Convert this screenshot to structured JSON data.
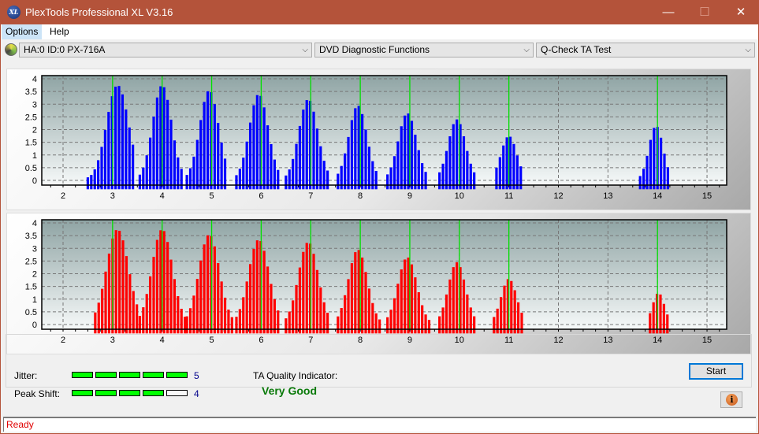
{
  "window": {
    "title": "PlexTools Professional XL V3.16",
    "minimize_glyph": "—",
    "maximize_glyph": "☐",
    "close_glyph": "✕"
  },
  "menubar": {
    "items": [
      {
        "label": "Options"
      },
      {
        "label": "Help"
      }
    ]
  },
  "toolbar": {
    "drive_select": "HA:0 ID:0  PX-716A",
    "function_select": "DVD Diagnostic Functions",
    "test_select": "Q-Check TA Test",
    "chevron": "⌵"
  },
  "results": {
    "jitter_label": "Jitter:",
    "jitter_value": "5",
    "jitter_level": 5,
    "peak_shift_label": "Peak Shift:",
    "peak_shift_value": "4",
    "peak_shift_level": 4,
    "max_level": 5,
    "ta_quality_label": "TA Quality Indicator:",
    "ta_quality_value": "Very Good",
    "start_label": "Start",
    "info_glyph": "i"
  },
  "status": {
    "text": "Ready"
  },
  "colors": {
    "title_bar": "#b4533a",
    "good": "#00ff00",
    "top_series": "#0000ff",
    "bottom_series": "#ff0000",
    "marker": "#00ff00",
    "quality_text": "#0a7a0a",
    "status_text": "#e00000"
  },
  "chart_data": [
    {
      "type": "bar",
      "name": "TA histogram (land/upper)",
      "series_color": "#0000ff",
      "xlim": [
        1.55,
        15.4
      ],
      "ylim": [
        0,
        4
      ],
      "x_ticks": [
        "2",
        "3",
        "4",
        "5",
        "6",
        "7",
        "8",
        "9",
        "10",
        "11",
        "12",
        "13",
        "14",
        "15"
      ],
      "y_ticks": [
        "0",
        "0.5",
        "1",
        "1.5",
        "2",
        "2.5",
        "3",
        "3.5",
        "4"
      ],
      "grid": true,
      "marker_lines": [
        3,
        4,
        5,
        6,
        7,
        8,
        9,
        10,
        11,
        14
      ],
      "peaks": [
        {
          "center": 3.1,
          "peak": 3.75,
          "width": 0.28,
          "from": 2.5,
          "to": 3.45
        },
        {
          "center": 4.0,
          "peak": 3.75,
          "width": 0.24,
          "from": 3.55,
          "to": 4.45
        },
        {
          "center": 4.95,
          "peak": 3.55,
          "width": 0.24,
          "from": 4.5,
          "to": 5.3
        },
        {
          "center": 5.95,
          "peak": 3.4,
          "width": 0.24,
          "from": 5.5,
          "to": 6.35
        },
        {
          "center": 6.95,
          "peak": 3.2,
          "width": 0.24,
          "from": 6.5,
          "to": 7.35
        },
        {
          "center": 7.95,
          "peak": 2.95,
          "width": 0.23,
          "from": 7.55,
          "to": 8.35
        },
        {
          "center": 8.95,
          "peak": 2.65,
          "width": 0.23,
          "from": 8.55,
          "to": 9.35
        },
        {
          "center": 9.95,
          "peak": 2.4,
          "width": 0.22,
          "from": 9.6,
          "to": 10.35
        },
        {
          "center": 11.0,
          "peak": 1.75,
          "width": 0.2,
          "from": 10.75,
          "to": 11.3
        },
        {
          "center": 13.97,
          "peak": 2.15,
          "width": 0.18,
          "from": 13.65,
          "to": 14.22
        }
      ]
    },
    {
      "type": "bar",
      "name": "TA histogram (pit/lower)",
      "series_color": "#ff0000",
      "xlim": [
        1.55,
        15.4
      ],
      "ylim": [
        0,
        4
      ],
      "x_ticks": [
        "2",
        "3",
        "4",
        "5",
        "6",
        "7",
        "8",
        "9",
        "10",
        "11",
        "12",
        "13",
        "14",
        "15"
      ],
      "y_ticks": [
        "0",
        "0.5",
        "1",
        "1.5",
        "2",
        "2.5",
        "3",
        "3.5",
        "4"
      ],
      "grid": true,
      "marker_lines": [
        3,
        4,
        5,
        6,
        7,
        8,
        9,
        10,
        11,
        14
      ],
      "peaks": [
        {
          "center": 3.1,
          "peak": 3.75,
          "width": 0.28,
          "from": 2.65,
          "to": 3.5
        },
        {
          "center": 4.0,
          "peak": 3.75,
          "width": 0.26,
          "from": 3.55,
          "to": 4.5
        },
        {
          "center": 4.95,
          "peak": 3.55,
          "width": 0.26,
          "from": 4.5,
          "to": 5.45
        },
        {
          "center": 5.95,
          "peak": 3.35,
          "width": 0.26,
          "from": 5.5,
          "to": 6.35
        },
        {
          "center": 6.95,
          "peak": 3.25,
          "width": 0.25,
          "from": 6.5,
          "to": 7.4
        },
        {
          "center": 7.95,
          "peak": 2.95,
          "width": 0.24,
          "from": 7.55,
          "to": 8.4
        },
        {
          "center": 8.95,
          "peak": 2.65,
          "width": 0.24,
          "from": 8.55,
          "to": 9.4
        },
        {
          "center": 9.95,
          "peak": 2.45,
          "width": 0.22,
          "from": 9.6,
          "to": 10.35
        },
        {
          "center": 11.0,
          "peak": 1.8,
          "width": 0.2,
          "from": 10.7,
          "to": 11.27
        },
        {
          "center": 14.02,
          "peak": 1.25,
          "width": 0.15,
          "from": 13.85,
          "to": 14.22
        }
      ]
    }
  ]
}
